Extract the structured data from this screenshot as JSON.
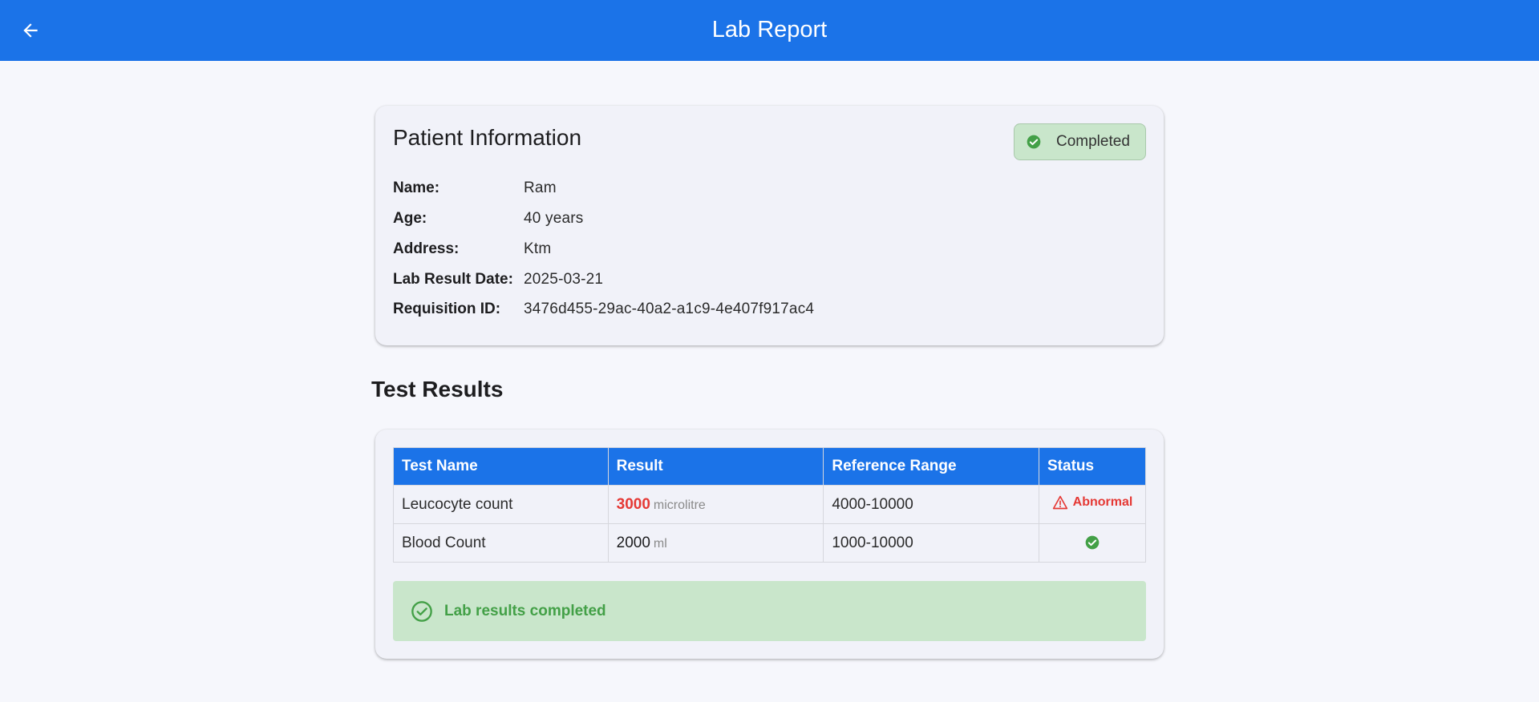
{
  "appbar": {
    "back_icon": "arrow-left-icon",
    "title": "Lab Report"
  },
  "patient": {
    "heading": "Patient Information",
    "status_icon": "check-circle-icon",
    "status_label": "Completed",
    "status_color": "#43a047",
    "fields": [
      {
        "label": "Name:",
        "value": "Ram"
      },
      {
        "label": "Age:",
        "value": "40 years"
      },
      {
        "label": "Address:",
        "value": "Ktm"
      },
      {
        "label": "Lab Result Date:",
        "value": "2025-03-21"
      },
      {
        "label": "Requisition ID:",
        "value": "3476d455-29ac-40a2-a1c9-4e407f917ac4"
      }
    ]
  },
  "results": {
    "heading": "Test Results",
    "columns": [
      "Test Name",
      "Result",
      "Reference Range",
      "Status"
    ],
    "rows": [
      {
        "test": "Leucocyte count",
        "value": "3000",
        "unit": "microlitre",
        "range": "4000-10000",
        "status": "Abnormal",
        "status_icon": "warning-triangle-icon"
      },
      {
        "test": "Blood Count",
        "value": "2000",
        "unit": "ml",
        "range": "1000-10000",
        "status": "",
        "status_icon": "check-circle-icon"
      }
    ],
    "banner_icon": "check-circle-outline-icon",
    "banner_text": "Lab results completed"
  },
  "colors": {
    "primary": "#1b73e8",
    "abnormal": "#e53935",
    "success": "#43a047",
    "success_bg": "#c9e6cb"
  }
}
